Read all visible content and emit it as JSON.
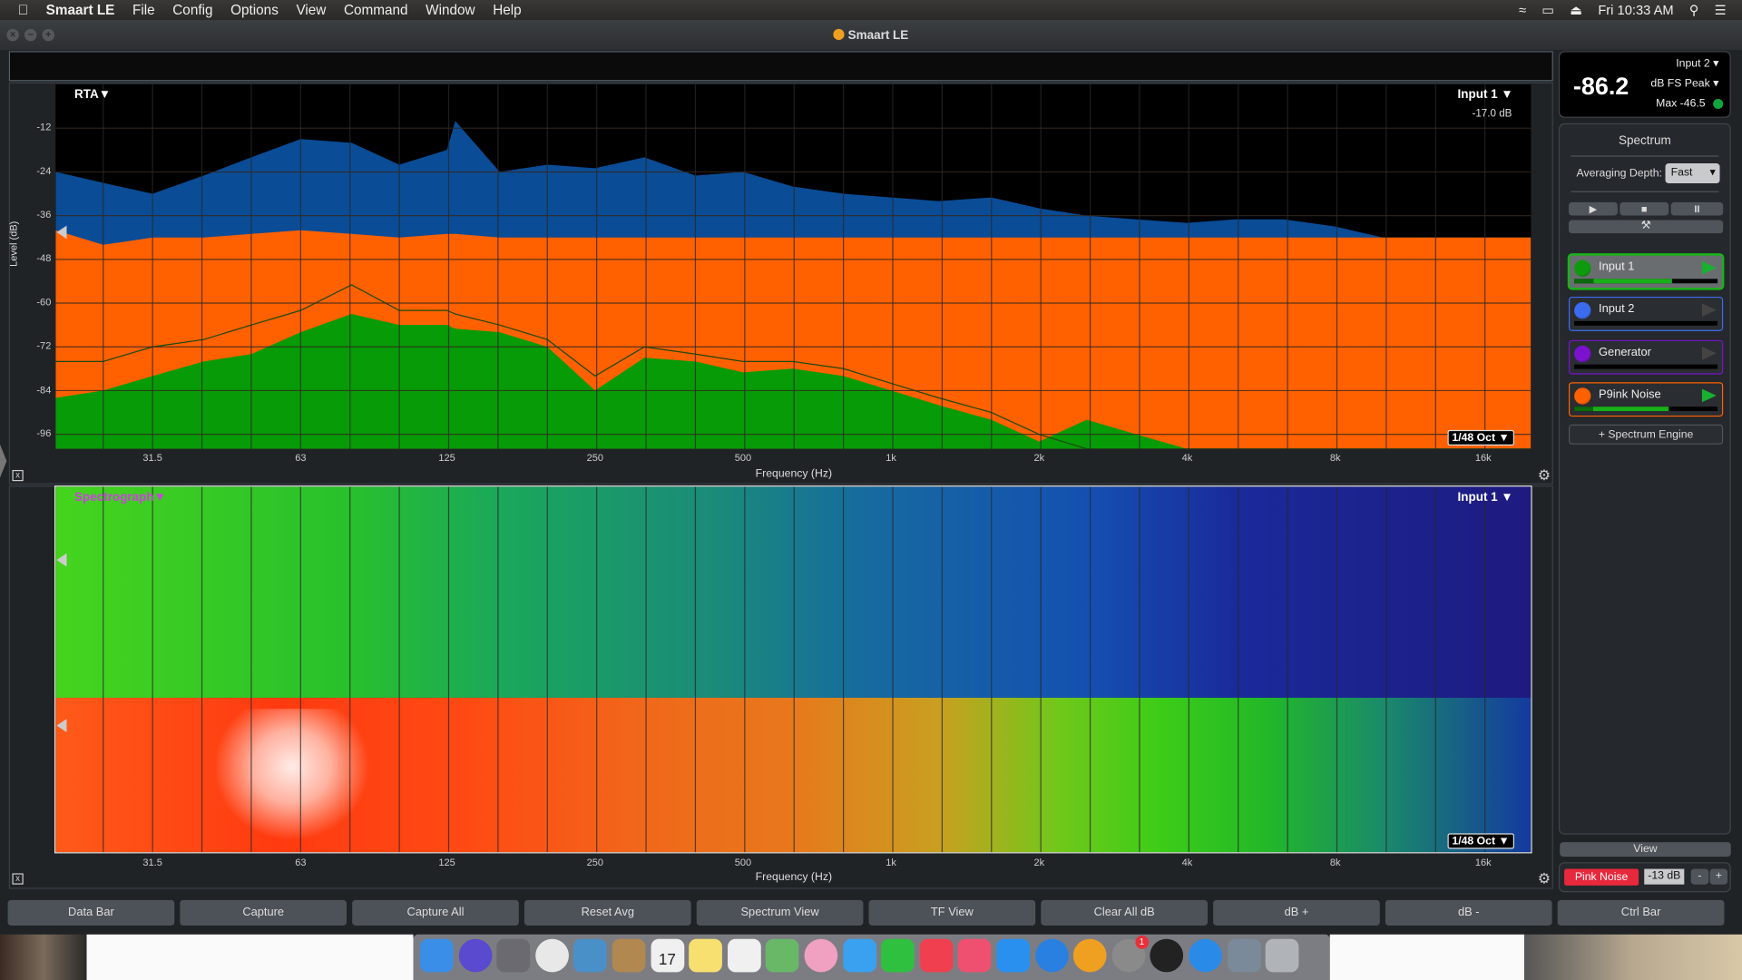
{
  "menubar": {
    "app_name": "Smaart LE",
    "items": [
      "File",
      "Config",
      "Options",
      "View",
      "Command",
      "Window",
      "Help"
    ],
    "clock": "Fri 10:33 AM"
  },
  "window": {
    "title": "Smaart LE"
  },
  "rta": {
    "mode_label": "RTA▼",
    "input_label": "Input 1 ▼",
    "input_offset": "-17.0 dB",
    "resolution": "1/48 Oct ▼"
  },
  "spectrograph": {
    "mode_label": "Spectrograph▼",
    "input_label": "Input 1 ▼",
    "resolution": "1/48 Oct ▼",
    "xlabel": "Frequency (Hz)",
    "xticks": [
      "31.5",
      "63",
      "125",
      "250",
      "500",
      "1k",
      "2k",
      "4k",
      "8k",
      "16k"
    ]
  },
  "chart_data": {
    "type": "area",
    "xlabel": "Frequency (Hz)",
    "ylabel": "Level (dB)",
    "x_scale": "log",
    "xlim": [
      20,
      20000
    ],
    "ylim": [
      -100,
      0
    ],
    "grid": true,
    "xtick_values": [
      31.5,
      63,
      125,
      250,
      500,
      1000,
      2000,
      4000,
      8000,
      16000
    ],
    "xticks": [
      "31.5",
      "63",
      "125",
      "250",
      "500",
      "1k",
      "2k",
      "4k",
      "8k",
      "16k"
    ],
    "yticks": [
      -12,
      -24,
      -36,
      -48,
      -60,
      -72,
      -84,
      -96
    ],
    "x": [
      20,
      25,
      31.5,
      40,
      50,
      63,
      80,
      100,
      125,
      130,
      160,
      200,
      250,
      315,
      400,
      500,
      630,
      800,
      1000,
      1250,
      1600,
      2000,
      2500,
      3150,
      4000,
      5000,
      6300,
      8000,
      10000,
      12500,
      16000,
      20000
    ],
    "series": [
      {
        "name": "Input 2",
        "color": "#0a4c96",
        "values": [
          -24,
          -27,
          -30,
          -25,
          -20,
          -15,
          -16,
          -22,
          -18,
          -10,
          -24,
          -22,
          -23,
          -20,
          -25,
          -24,
          -28,
          -30,
          -31,
          -32,
          -31,
          -34,
          -36,
          -37,
          -38,
          -37,
          -37,
          -39,
          -42,
          -42,
          -42,
          -42
        ]
      },
      {
        "name": "P9ink Noise",
        "color": "#ff6000",
        "values": [
          -40,
          -44,
          -42,
          -42,
          -41,
          -40,
          -41,
          -42,
          -41,
          -41,
          -42,
          -42,
          -42,
          -42,
          -42,
          -42,
          -42,
          -42,
          -42,
          -42,
          -42,
          -42,
          -42,
          -42,
          -42,
          -42,
          -42,
          -42,
          -42,
          -42,
          -42,
          -42
        ]
      },
      {
        "name": "Input 1",
        "color": "#079b07",
        "values": [
          -86,
          -84,
          -80,
          -76,
          -74,
          -68,
          -63,
          -66,
          -66,
          -67,
          -68,
          -72,
          -84,
          -75,
          -76,
          -79,
          -78,
          -80,
          -84,
          -88,
          -92,
          -98,
          -92,
          -96,
          -100,
          -100,
          -100,
          -100,
          -100,
          -100,
          -100,
          -100
        ]
      },
      {
        "color": "#1a4a10",
        "values": [
          -76,
          -76,
          -72,
          -70,
          -66,
          -62,
          -55,
          -62,
          -62,
          -63,
          -66,
          -70,
          -80,
          -72,
          -74,
          -76,
          -76,
          -78,
          -82,
          -86,
          -90,
          -96,
          -100,
          -100,
          -100,
          -100,
          -100,
          -100,
          -100,
          -100,
          -100,
          -100
        ]
      }
    ]
  },
  "meter": {
    "value": "-86.2",
    "source": "Input 2",
    "unit": "dB FS Peak",
    "max": "Max -46.5",
    "status_color": "#0fa83a"
  },
  "spectrum_panel": {
    "title": "Spectrum",
    "averaging_label": "Averaging Depth:",
    "averaging_value": "Fast",
    "sources": [
      {
        "label": "Input 1",
        "color": "#0e9a0e",
        "border": "#17b417",
        "active": true,
        "level": 0.68
      },
      {
        "label": "Input 2",
        "color": "#3b6cf0",
        "border": "#3b6cf0",
        "active": false,
        "level": 0
      },
      {
        "label": "Generator",
        "color": "#7b12d0",
        "border": "#7b12d0",
        "active": false,
        "level": 0
      },
      {
        "label": "P9ink Noise",
        "color": "#ff6000",
        "border": "#ff6000",
        "active": true,
        "level": 0.66
      }
    ],
    "add_engine": "+ Spectrum Engine",
    "view": "View"
  },
  "generator": {
    "label": "Pink Noise",
    "level": "-13 dB",
    "minus": "-",
    "plus": "+"
  },
  "bottom_buttons": [
    "Data Bar",
    "Capture",
    "Capture All",
    "Reset Avg",
    "Spectrum View",
    "TF View",
    "Clear All dB",
    "dB +",
    "dB -",
    "Ctrl Bar"
  ],
  "dock": [
    "finder",
    "siri",
    "launchpad",
    "chrome",
    "preview",
    "contacts",
    "calendar",
    "notes",
    "reminders",
    "maps",
    "photos",
    "messages",
    "facetime",
    "news",
    "music",
    "app-store",
    "safari",
    "smaart",
    "system-preferences",
    "m-app",
    "wifi-utility",
    "image-capture",
    "trash"
  ],
  "calendar_badge": "17",
  "sysprefs_badge": "1"
}
